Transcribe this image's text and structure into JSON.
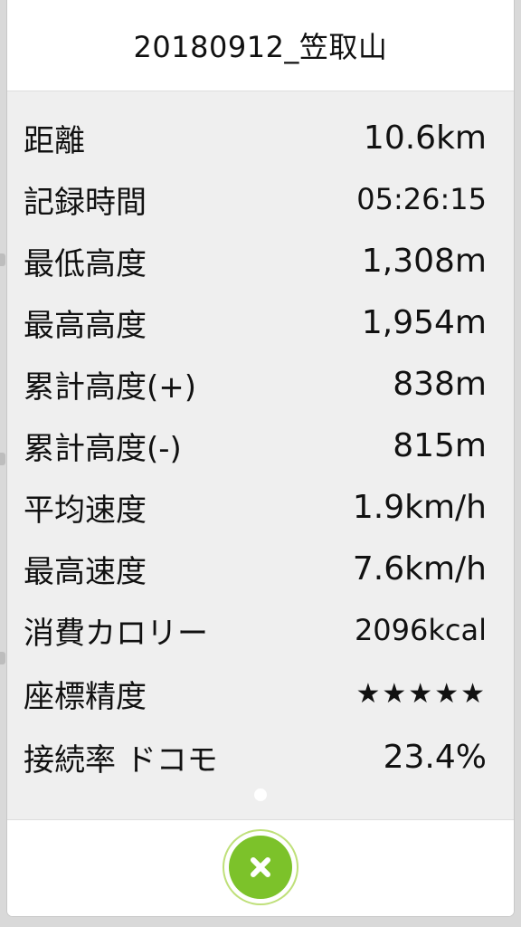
{
  "dialog": {
    "title": "20180912_笠取山"
  },
  "stats": [
    {
      "label": "距離",
      "value": "10.6km"
    },
    {
      "label": "記録時間",
      "value": "05:26:15"
    },
    {
      "label": "最低高度",
      "value": "1,308m"
    },
    {
      "label": "最高高度",
      "value": "1,954m"
    },
    {
      "label": "累計高度(+)",
      "value": "838m"
    },
    {
      "label": "累計高度(-)",
      "value": "815m"
    },
    {
      "label": "平均速度",
      "value": "1.9km/h"
    },
    {
      "label": "最高速度",
      "value": "7.6km/h"
    },
    {
      "label": "消費カロリー",
      "value": "2096kcal"
    },
    {
      "label": "座標精度",
      "value": "★★★★★"
    },
    {
      "label": "接続率 ドコモ",
      "value": "23.4%"
    }
  ],
  "footer": {
    "close_icon": "close-x-icon",
    "accent_color": "#7cc22a"
  }
}
